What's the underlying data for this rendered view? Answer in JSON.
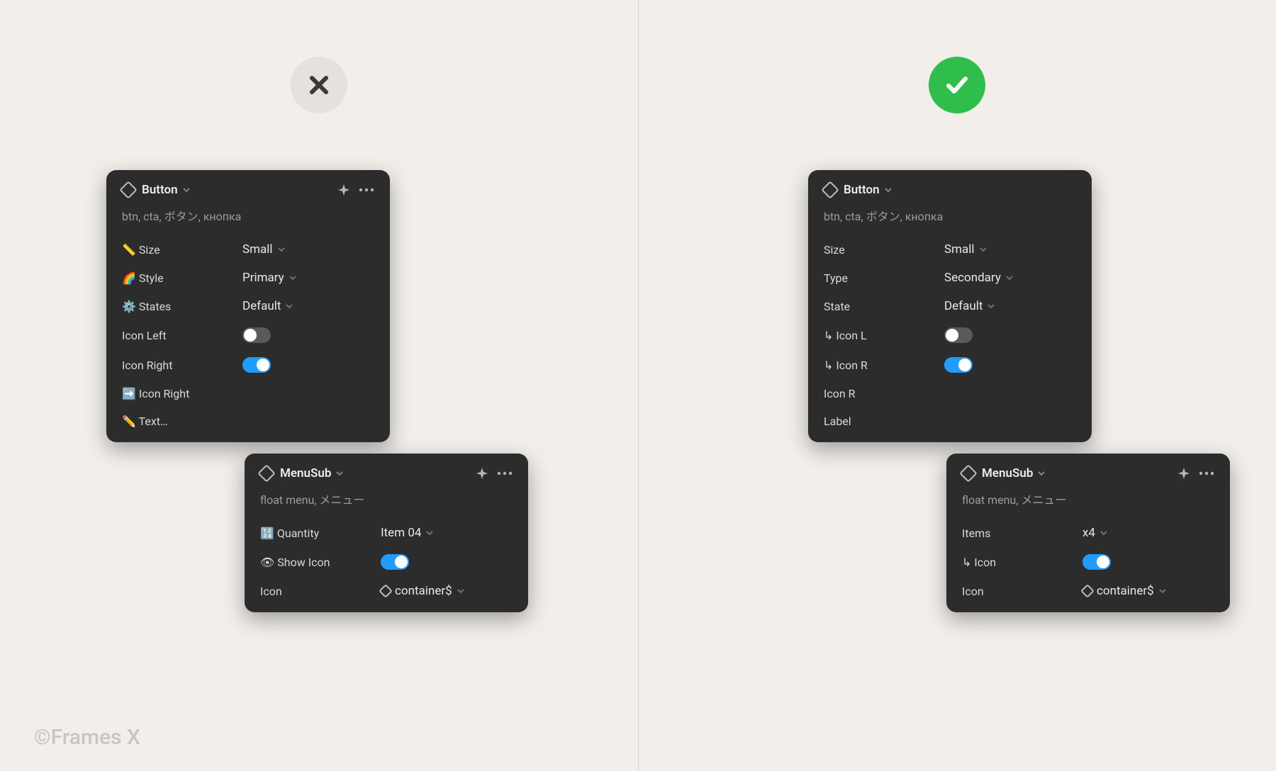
{
  "credit": "©Frames X",
  "badges": {
    "bad": "x",
    "good": "check"
  },
  "left": {
    "button_panel": {
      "title": "Button",
      "desc": "btn, cta, ボタン, кнопка",
      "rows": [
        {
          "label": "📏 Size",
          "value": "Small",
          "kind": "drop"
        },
        {
          "label": "🌈 Style",
          "value": "Primary",
          "kind": "drop"
        },
        {
          "label": "⚙️ States",
          "value": "Default",
          "kind": "drop"
        },
        {
          "label": "Icon Left",
          "kind": "toggle",
          "on": false
        },
        {
          "label": "Icon Right",
          "kind": "toggle",
          "on": true
        },
        {
          "label": "➡️ Icon Right",
          "kind": "text"
        },
        {
          "label": "✏️ Text…",
          "kind": "text"
        }
      ]
    },
    "menu_panel": {
      "title": "MenuSub",
      "desc": "float menu, メニュー",
      "rows": [
        {
          "label": "🔢 Quantity",
          "value": "Item 04",
          "kind": "drop"
        },
        {
          "label": "👁 Show Icon",
          "kind": "toggle",
          "on": true
        },
        {
          "label": "Icon",
          "value": "container$",
          "kind": "comp"
        }
      ]
    }
  },
  "right": {
    "button_panel": {
      "title": "Button",
      "desc": "btn, cta, ボタン, кнопка",
      "rows": [
        {
          "label": "Size",
          "value": "Small",
          "kind": "drop"
        },
        {
          "label": "Type",
          "value": "Secondary",
          "kind": "drop"
        },
        {
          "label": "State",
          "value": "Default",
          "kind": "drop"
        },
        {
          "label": "↳ Icon L",
          "kind": "toggle",
          "on": false
        },
        {
          "label": "↳ Icon R",
          "kind": "toggle",
          "on": true
        },
        {
          "label": "Icon R",
          "kind": "text"
        },
        {
          "label": "Label",
          "kind": "text"
        }
      ]
    },
    "menu_panel": {
      "title": "MenuSub",
      "desc": "float menu, メニュー",
      "rows": [
        {
          "label": "Items",
          "value": "x4",
          "kind": "drop"
        },
        {
          "label": "↳ Icon",
          "kind": "toggle",
          "on": true
        },
        {
          "label": "Icon",
          "value": "container$",
          "kind": "comp"
        }
      ]
    }
  }
}
